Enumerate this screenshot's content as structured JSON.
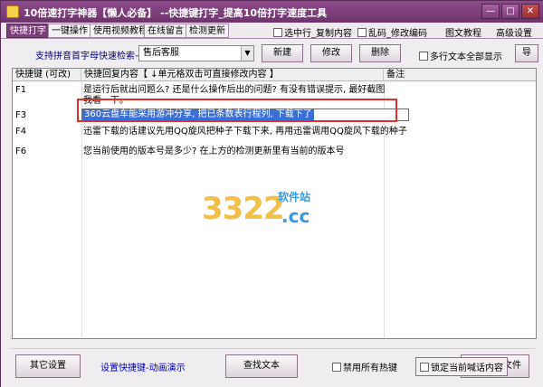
{
  "window": {
    "title": "10倍速打字神器【懒人必备】 --快捷键打字_提高10倍打字速度工具"
  },
  "titlebar_buttons": {
    "minimize": "—",
    "maximize": "□",
    "close": "✕"
  },
  "menubar": {
    "tabs": [
      "快捷打字",
      "一键操作",
      "使用视频教程",
      "在线留言",
      "检测更新"
    ],
    "checks": [
      "选中行_复制内容",
      "乱码_修改编码"
    ],
    "links": [
      "图文教程",
      "高级设置"
    ]
  },
  "toolbar": {
    "search_label": "支持拼音首字母快速检索→",
    "category_select": "售后客服",
    "new_button": "新建",
    "edit_button": "修改",
    "delete_button": "删除",
    "multiline_check": "多行文本全部显示",
    "import_button": "导"
  },
  "table": {
    "headers": [
      "快捷键 (可改)",
      "快捷回复内容【 ↓单元格双击可直接修改内容 】",
      "备注"
    ],
    "rows": [
      {
        "key": "F1",
        "text": "是运行后就出问题么? 还是什么操作后出的问题? 有没有错误提示, 最好截图我看一下。"
      },
      {
        "key": "F3",
        "text": "360云盘车能采用游冲分享, 把已条数表行程列, 下载下了"
      },
      {
        "key": "F4",
        "text": "迅雷下载的话建议先用QQ旋风把种子下载下来, 再用迅雷调用QQ旋风下载的种子"
      },
      {
        "key": "F6",
        "text": "您当前使用的版本号是多少? 在上方的检测更新里有当前的版本号"
      }
    ]
  },
  "watermark": {
    "number": "3322",
    "domain": ".cc",
    "site": "软件站"
  },
  "bottom": {
    "other_settings_button": "其它设置",
    "hotkey_link": "设置快捷键-动画演示",
    "search_text_button": "查找文本",
    "disable_hotkeys_check": "禁用所有热键",
    "lock_check": "锁定当前喊话内容",
    "file_button": "文件"
  }
}
